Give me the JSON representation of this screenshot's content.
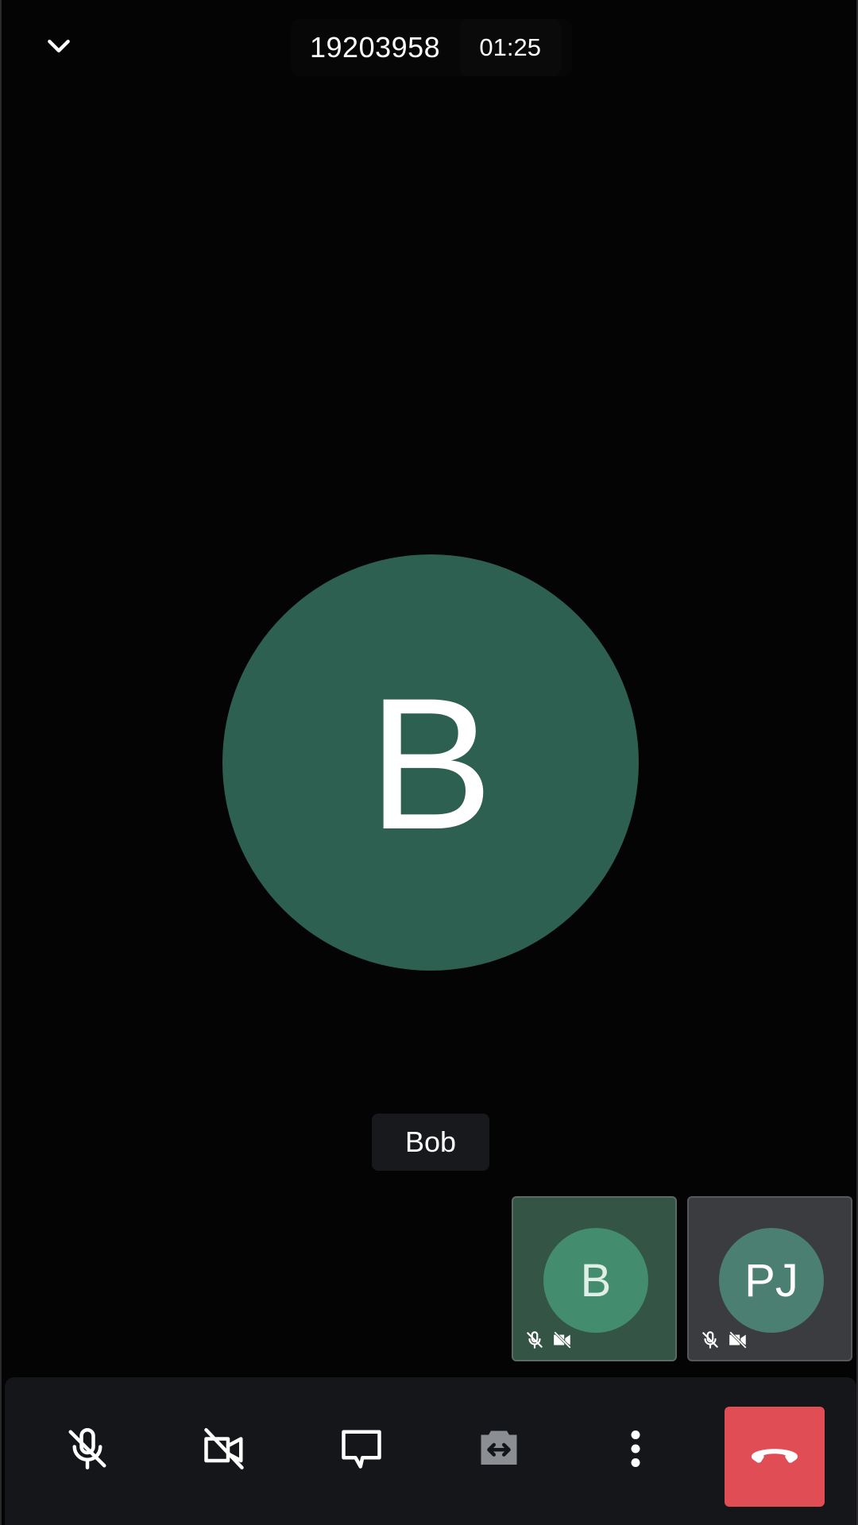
{
  "header": {
    "room_id": "19203958",
    "timer": "01:25"
  },
  "stage": {
    "avatar_initial": "B",
    "avatar_color": "#2e6052",
    "speaker_name": "Bob"
  },
  "participants": [
    {
      "initials": "B",
      "avatar_color": "#438c6e",
      "tile_color": "#345445",
      "mic": "muted",
      "camera": "off"
    },
    {
      "initials": "PJ",
      "avatar_color": "#4a7f71",
      "tile_color": "#3b3c40",
      "mic": "muted",
      "camera": "off"
    }
  ],
  "toolbar": {
    "buttons": [
      {
        "icon": "mic-off-icon"
      },
      {
        "icon": "camera-off-icon"
      },
      {
        "icon": "chat-icon"
      },
      {
        "icon": "switch-camera-icon"
      },
      {
        "icon": "more-vertical-icon"
      },
      {
        "icon": "hangup-icon",
        "color": "#e04d55"
      }
    ]
  }
}
